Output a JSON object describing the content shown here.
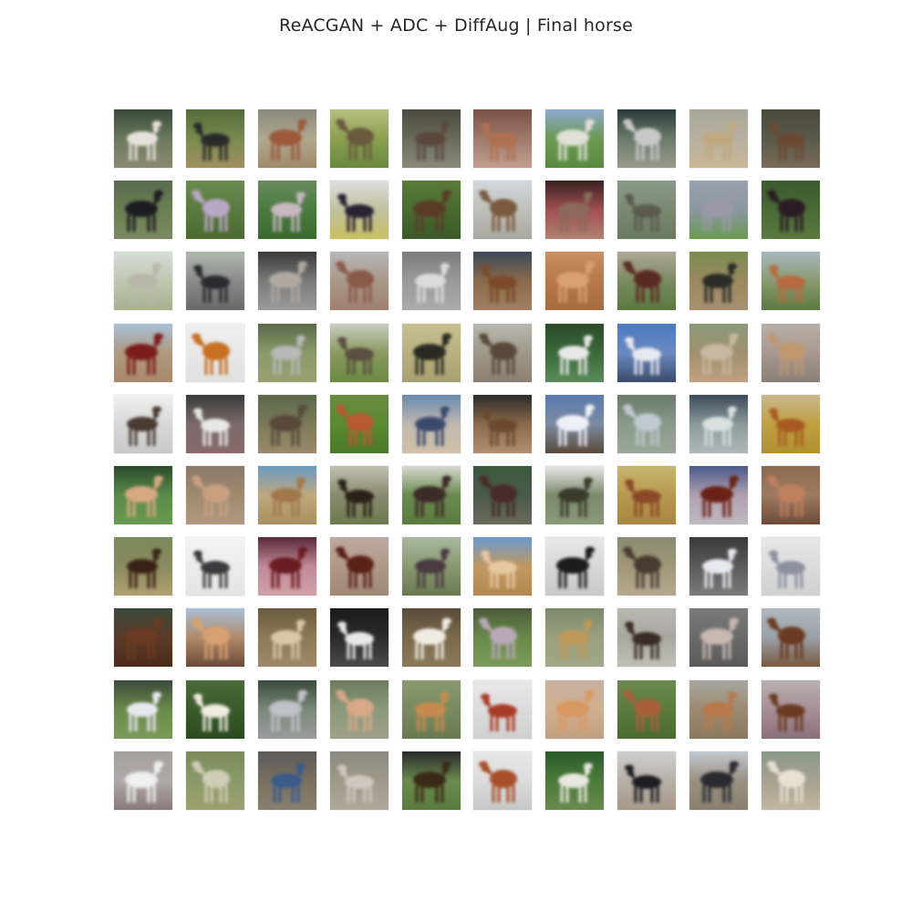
{
  "figure": {
    "title": "ReACGAN + ADC + DiffAug | Final horse"
  },
  "grid": {
    "rows": 10,
    "cols": 10,
    "tiles": [
      {
        "bg": [
          "#3a4a3a",
          "#6a7a5a",
          "#8a8a70"
        ],
        "horse": "#e8e2dc"
      },
      {
        "bg": [
          "#556a3a",
          "#7a8a50",
          "#a09060"
        ],
        "horse": "#2a2a2c"
      },
      {
        "bg": [
          "#8a8a7a",
          "#b0a890",
          "#a08a6a"
        ],
        "horse": "#9a5a3a"
      },
      {
        "bg": [
          "#b8c080",
          "#8aa050",
          "#6a8a40"
        ],
        "horse": "#6a5a40"
      },
      {
        "bg": [
          "#4a4a40",
          "#6a6a5a",
          "#8a8a7a"
        ],
        "horse": "#5a4a3a"
      },
      {
        "bg": [
          "#7a5048",
          "#a07a6a",
          "#c0a090"
        ],
        "horse": "#b07050"
      },
      {
        "bg": [
          "#90a8d0",
          "#6a9a50",
          "#5a8a40"
        ],
        "horse": "#e0e0d8"
      },
      {
        "bg": [
          "#2a3a3a",
          "#6a7a6a",
          "#9a9a8a"
        ],
        "horse": "#c8c8c8"
      },
      {
        "bg": [
          "#a8a898",
          "#b8b0a0",
          "#c8b898"
        ],
        "horse": "#c0a880"
      },
      {
        "bg": [
          "#4a4a3a",
          "#5a5a4a",
          "#7a6a5a"
        ],
        "horse": "#6a4a30"
      },
      {
        "bg": [
          "#5a6a50",
          "#6a8050",
          "#7a8a60"
        ],
        "horse": "#1e1e20"
      },
      {
        "bg": [
          "#6a8a50",
          "#5a7a40",
          "#4a6a30"
        ],
        "horse": "#b8a8c8"
      },
      {
        "bg": [
          "#6a8a60",
          "#4a7a40",
          "#3a6a30"
        ],
        "horse": "#c8b8c0"
      },
      {
        "bg": [
          "#e0e0e0",
          "#c0c0a0",
          "#c8c060"
        ],
        "horse": "#2a2030"
      },
      {
        "bg": [
          "#5a7a3a",
          "#4a6a30",
          "#3a5a28"
        ],
        "horse": "#5a3a28"
      },
      {
        "bg": [
          "#d0d8e0",
          "#c0c0b8",
          "#a8a8a0"
        ],
        "horse": "#7a5a40"
      },
      {
        "bg": [
          "#3a2020",
          "#a05050",
          "#b08070"
        ],
        "horse": "#8a6a5a"
      },
      {
        "bg": [
          "#8a9a8a",
          "#7a8a70",
          "#6a7a60"
        ],
        "horse": "#5a5a50"
      },
      {
        "bg": [
          "#9aa0b0",
          "#8a98a0",
          "#6a9a50"
        ],
        "horse": "#9a98a8"
      },
      {
        "bg": [
          "#3a5a30",
          "#4a6a38",
          "#5a7a40"
        ],
        "horse": "#2a1a20"
      },
      {
        "bg": [
          "#d8dcd8",
          "#c0c8b0",
          "#a8b090"
        ],
        "horse": "#b8b8a8"
      },
      {
        "bg": [
          "#b0b8b0",
          "#8a8a8a",
          "#6a6a6a"
        ],
        "horse": "#2a2a2e"
      },
      {
        "bg": [
          "#3a3a3a",
          "#7a7a7a",
          "#9a9a9a"
        ],
        "horse": "#b0a8a0"
      },
      {
        "bg": [
          "#b8b8b8",
          "#a89888",
          "#a08070"
        ],
        "horse": "#8a5a48"
      },
      {
        "bg": [
          "#7a7a7a",
          "#9a9a9a",
          "#aaaaaa"
        ],
        "horse": "#dcdcdc"
      },
      {
        "bg": [
          "#3a4a5a",
          "#8a6a4a",
          "#a08060"
        ],
        "horse": "#7a4a2a"
      },
      {
        "bg": [
          "#c89060",
          "#b87848",
          "#a86a40"
        ],
        "horse": "#d8a070"
      },
      {
        "bg": [
          "#b0a898",
          "#7a8a60",
          "#5a7a40"
        ],
        "horse": "#5a2a20"
      },
      {
        "bg": [
          "#7a8a50",
          "#9a8a60",
          "#a89070"
        ],
        "horse": "#2a2a28"
      },
      {
        "bg": [
          "#a8b8c0",
          "#8a9a70",
          "#5a7a40"
        ],
        "horse": "#b86a40"
      },
      {
        "bg": [
          "#a8c0d8",
          "#b09880",
          "#a88a6a"
        ],
        "horse": "#7a1a1a"
      },
      {
        "bg": [
          "#f0f0f0",
          "#e8e8e8",
          "#e0e0e0"
        ],
        "horse": "#c87020"
      },
      {
        "bg": [
          "#5a6a4a",
          "#8a9a6a",
          "#9aa070"
        ],
        "horse": "#b8b8b8"
      },
      {
        "bg": [
          "#c8ccc0",
          "#8a9a60",
          "#6a8a40"
        ],
        "horse": "#5a5040"
      },
      {
        "bg": [
          "#c8c090",
          "#b8b080",
          "#a8a070"
        ],
        "horse": "#2a2a20"
      },
      {
        "bg": [
          "#b8b8b0",
          "#a09888",
          "#8a8070"
        ],
        "horse": "#5a4a3a"
      },
      {
        "bg": [
          "#2a4a2a",
          "#3a6a3a",
          "#5a8a5a"
        ],
        "horse": "#e8e8e8"
      },
      {
        "bg": [
          "#4a7ac0",
          "#6a8ac0",
          "#3a4a6a"
        ],
        "horse": "#e8e8f0"
      },
      {
        "bg": [
          "#8a9a7a",
          "#a09070",
          "#c0a080"
        ],
        "horse": "#c8b8a0"
      },
      {
        "bg": [
          "#b8b0a8",
          "#a89890",
          "#8a8078"
        ],
        "horse": "#c09870"
      },
      {
        "bg": [
          "#f0f0f0",
          "#d8d8d8",
          "#c8c8c8"
        ],
        "horse": "#4a3a30"
      },
      {
        "bg": [
          "#3a3a3a",
          "#7a6a6a",
          "#8a6a6a"
        ],
        "horse": "#e8e8e8"
      },
      {
        "bg": [
          "#5a6a4a",
          "#7a7a5a",
          "#9a8a6a"
        ],
        "horse": "#5a4a3a"
      },
      {
        "bg": [
          "#6a8a40",
          "#5a8a30",
          "#4a7a28"
        ],
        "horse": "#b85a30"
      },
      {
        "bg": [
          "#6a8ab0",
          "#c0b8b0",
          "#d0c0a8"
        ],
        "horse": "#3a4a6a"
      },
      {
        "bg": [
          "#2a2a2a",
          "#8a6a4a",
          "#b09070"
        ],
        "horse": "#6a4a30"
      },
      {
        "bg": [
          "#5a7ab0",
          "#7a8aa0",
          "#5a4a3a"
        ],
        "horse": "#f0f0f8"
      },
      {
        "bg": [
          "#6a7a6a",
          "#8a9a8a",
          "#9aa89a"
        ],
        "horse": "#c0c8d0"
      },
      {
        "bg": [
          "#3a4a5a",
          "#8a9a9a",
          "#b0b8b8"
        ],
        "horse": "#d8e0e0"
      },
      {
        "bg": [
          "#c8b890",
          "#c0a040",
          "#b09030"
        ],
        "horse": "#a85a20"
      },
      {
        "bg": [
          "#2a4a2a",
          "#5a8a4a",
          "#6a9a50"
        ],
        "horse": "#d8a880"
      },
      {
        "bg": [
          "#8a7a6a",
          "#a08a70",
          "#b09880"
        ],
        "horse": "#c8a080"
      },
      {
        "bg": [
          "#6a9ac0",
          "#c0a880",
          "#a89060"
        ],
        "horse": "#a07848"
      },
      {
        "bg": [
          "#c0c0b0",
          "#8a8a70",
          "#6a7a50"
        ],
        "horse": "#2a2018"
      },
      {
        "bg": [
          "#d8d8d0",
          "#6a8a50",
          "#5a7a40"
        ],
        "horse": "#3a2a28"
      },
      {
        "bg": [
          "#3a5a3a",
          "#4a5a4a",
          "#6a6a5a"
        ],
        "horse": "#4a2a2a"
      },
      {
        "bg": [
          "#e8e8e8",
          "#7a8a6a",
          "#8a9a7a"
        ],
        "horse": "#3a3a2a"
      },
      {
        "bg": [
          "#c8b870",
          "#b89850",
          "#a88840"
        ],
        "horse": "#8a4a28"
      },
      {
        "bg": [
          "#4a5a8a",
          "#b0a0b0",
          "#c0b8c0"
        ],
        "horse": "#6a2018"
      },
      {
        "bg": [
          "#8a6a50",
          "#a07a60",
          "#6a4a38"
        ],
        "horse": "#c08060"
      },
      {
        "bg": [
          "#7a8a5a",
          "#8a8a60",
          "#b0a070"
        ],
        "horse": "#3a2418"
      },
      {
        "bg": [
          "#f4f4f4",
          "#ececec",
          "#e4e4e4"
        ],
        "horse": "#3a3a3c"
      },
      {
        "bg": [
          "#5a2a3a",
          "#c08a98",
          "#d0a0a8"
        ],
        "horse": "#6a1a20"
      },
      {
        "bg": [
          "#c0a8a0",
          "#b09888",
          "#a08878"
        ],
        "horse": "#5a2018"
      },
      {
        "bg": [
          "#a8b8a0",
          "#8a9a70",
          "#6a7a50"
        ],
        "horse": "#4a3a40"
      },
      {
        "bg": [
          "#6a9ad0",
          "#c09860",
          "#b08850"
        ],
        "horse": "#e8c8a0"
      },
      {
        "bg": [
          "#e8e8e8",
          "#d8d8d8",
          "#c8c8c8"
        ],
        "horse": "#1a1a1a"
      },
      {
        "bg": [
          "#8a8a70",
          "#a09878",
          "#b8a890"
        ],
        "horse": "#4a3a30"
      },
      {
        "bg": [
          "#3a3a3a",
          "#5a5a5a",
          "#7a7a7a"
        ],
        "horse": "#e8e8f0"
      },
      {
        "bg": [
          "#e8e8e8",
          "#dcdcdc",
          "#d0d0d0"
        ],
        "horse": "#8a90a0"
      },
      {
        "bg": [
          "#3a4a3a",
          "#5a3a28",
          "#4a2a18"
        ],
        "horse": "#6a3a20"
      },
      {
        "bg": [
          "#a8c0d8",
          "#b08a6a",
          "#6a4a3a"
        ],
        "horse": "#d8a070"
      },
      {
        "bg": [
          "#6a5a40",
          "#8a7a58",
          "#a08868"
        ],
        "horse": "#d8c8a8"
      },
      {
        "bg": [
          "#1a1a1a",
          "#2a2a2a",
          "#4a4a4a"
        ],
        "horse": "#e8e8e8"
      },
      {
        "bg": [
          "#5a4a3a",
          "#7a6a4a",
          "#8a7a5a"
        ],
        "horse": "#f0ece4"
      },
      {
        "bg": [
          "#4a5a3a",
          "#6a8a4a",
          "#7a9a5a"
        ],
        "horse": "#b8a8b8"
      },
      {
        "bg": [
          "#7a8a6a",
          "#9aa080",
          "#a0a888"
        ],
        "horse": "#c09858"
      },
      {
        "bg": [
          "#b8b8b0",
          "#a8a8a0",
          "#c0c0b8"
        ],
        "horse": "#3a2a28"
      },
      {
        "bg": [
          "#7a7a7a",
          "#6a6a6a",
          "#5a5a5a"
        ],
        "horse": "#c8b8b0"
      },
      {
        "bg": [
          "#b0b8c0",
          "#9aa0a8",
          "#7a5a40"
        ],
        "horse": "#6a3a20"
      },
      {
        "bg": [
          "#3a4a3a",
          "#6a8a4a",
          "#7a9a5a"
        ],
        "horse": "#e8e8f0"
      },
      {
        "bg": [
          "#4a6a3a",
          "#3a5a2a",
          "#2a4a20"
        ],
        "horse": "#f0ece0"
      },
      {
        "bg": [
          "#3a4a3a",
          "#7a8a7a",
          "#9a9a9a"
        ],
        "horse": "#c0c0c8"
      },
      {
        "bg": [
          "#6a7a5a",
          "#8a9a7a",
          "#a0a08a"
        ],
        "horse": "#d8a888"
      },
      {
        "bg": [
          "#8a9a70",
          "#7a8a60",
          "#6a7a50"
        ],
        "horse": "#c88a50"
      },
      {
        "bg": [
          "#e8e8e8",
          "#dcdcdc",
          "#d0d0d0"
        ],
        "horse": "#a83a28"
      },
      {
        "bg": [
          "#c8b0a0",
          "#d0b090",
          "#c0a080"
        ],
        "horse": "#d89860"
      },
      {
        "bg": [
          "#6a8a50",
          "#5a7a40",
          "#4a6a30"
        ],
        "horse": "#a8603a"
      },
      {
        "bg": [
          "#a8a8a0",
          "#9a8a70",
          "#8a7a60"
        ],
        "horse": "#b87848"
      },
      {
        "bg": [
          "#b8b0b0",
          "#a89098",
          "#8a7078"
        ],
        "horse": "#6a3a20"
      },
      {
        "bg": [
          "#a8a0a0",
          "#b0a8a8",
          "#8a7a78"
        ],
        "horse": "#f0f0f0"
      },
      {
        "bg": [
          "#7a8a5a",
          "#8a9a6a",
          "#a0a070"
        ],
        "horse": "#d0ccb8"
      },
      {
        "bg": [
          "#5a5a5a",
          "#7a7060",
          "#8a8070"
        ],
        "horse": "#3a5a8a"
      },
      {
        "bg": [
          "#8a8a80",
          "#a09888",
          "#b0a898"
        ],
        "horse": "#d0c8c0"
      },
      {
        "bg": [
          "#2a2a2a",
          "#6a8a50",
          "#5a7a40"
        ],
        "horse": "#3a2a18"
      },
      {
        "bg": [
          "#e8e8e8",
          "#dcdcdc",
          "#c8c8c8"
        ],
        "horse": "#a8502a"
      },
      {
        "bg": [
          "#2a5a2a",
          "#4a7a3a",
          "#6a8a50"
        ],
        "horse": "#e8e8e0"
      },
      {
        "bg": [
          "#d0d0d0",
          "#b8b0a8",
          "#a89888"
        ],
        "horse": "#1a1a20"
      },
      {
        "bg": [
          "#c0c8d0",
          "#9a9080",
          "#8a8070"
        ],
        "horse": "#2a2a30"
      },
      {
        "bg": [
          "#8a9a8a",
          "#a8a090",
          "#c0b8a0"
        ],
        "horse": "#e8e0d0"
      }
    ]
  }
}
